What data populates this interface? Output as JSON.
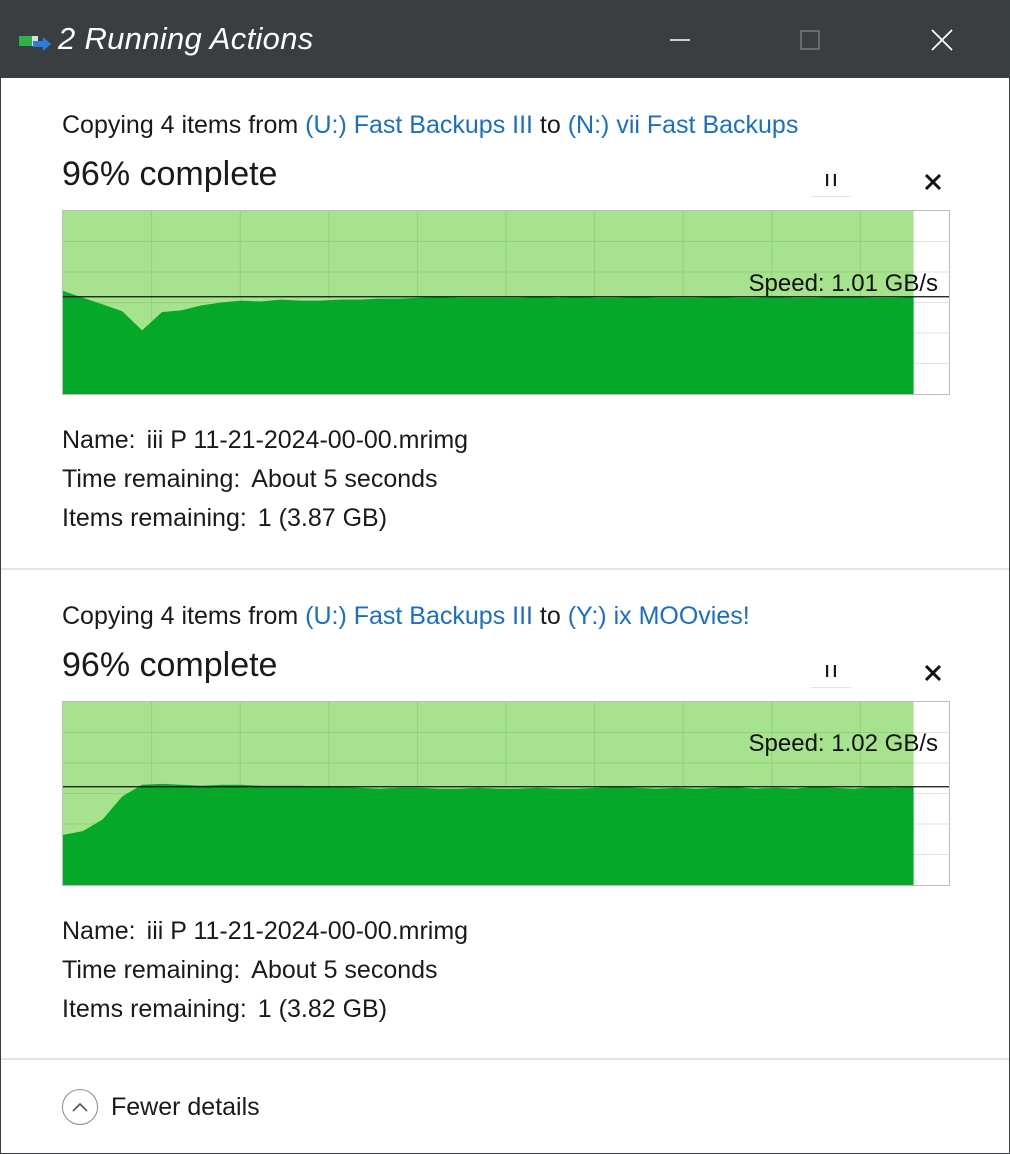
{
  "window": {
    "title": "2 Running Actions",
    "icon": "copy-operation-icon",
    "controls": [
      "minimize-icon",
      "maximize-icon",
      "close-icon"
    ]
  },
  "operations": [
    {
      "prefix": "Copying 4 items from ",
      "source": "(U:) Fast Backups III",
      "connector": " to ",
      "destination": "(N:) vii Fast Backups",
      "percent_text": "96% complete",
      "percent": 96,
      "speed_text": "Speed: 1.01 GB/s",
      "speed_gbps": 1.01,
      "name_label": "Name:",
      "name_value": "iii P 11-21-2024-00-00.mrimg",
      "time_label": "Time remaining:",
      "time_value": "About 5 seconds",
      "items_label": "Items remaining:",
      "items_value": "1 (3.87 GB)",
      "speed_history": [
        1.07,
        1.0,
        0.93,
        0.86,
        0.66,
        0.85,
        0.87,
        0.92,
        0.95,
        0.97,
        0.96,
        0.98,
        0.97,
        0.97,
        0.98,
        0.98,
        0.99,
        0.99,
        1.0,
        1.01,
        1.0,
        1.0,
        1.0,
        1.0,
        1.01,
        1.0,
        1.01,
        1.0,
        1.0,
        1.01,
        1.0,
        1.0,
        1.0,
        1.01,
        1.0,
        1.0,
        1.01,
        1.0,
        1.0,
        1.01,
        1.01,
        1.0,
        1.0,
        1.01
      ]
    },
    {
      "prefix": "Copying 4 items from ",
      "source": "(U:) Fast Backups III",
      "connector": " to ",
      "destination": "(Y:) ix MOOvies!",
      "percent_text": "96% complete",
      "percent": 96,
      "speed_text": "Speed: 1.02 GB/s",
      "speed_gbps": 1.02,
      "name_label": "Name:",
      "name_value": "iii P 11-21-2024-00-00.mrimg",
      "time_label": "Time remaining:",
      "time_value": "About 5 seconds",
      "items_label": "Items remaining:",
      "items_value": "1 (3.82 GB)",
      "speed_history": [
        0.52,
        0.56,
        0.68,
        0.92,
        1.04,
        1.05,
        1.04,
        1.03,
        1.04,
        1.04,
        1.03,
        1.03,
        1.03,
        1.02,
        1.02,
        1.01,
        1.0,
        1.01,
        1.01,
        1.0,
        1.0,
        1.01,
        1.0,
        1.0,
        1.01,
        1.0,
        1.0,
        1.01,
        1.02,
        1.01,
        1.0,
        1.01,
        1.0,
        1.01,
        1.02,
        1.0,
        1.01,
        1.0,
        1.02,
        1.01,
        1.0,
        1.02,
        1.01,
        1.02
      ]
    }
  ],
  "footer": {
    "label": "Fewer details",
    "icon": "chevron-up-icon"
  },
  "colors": {
    "titlebar": "#3a3e41",
    "link": "#1a6fc2",
    "graph_fill": "#06a82a",
    "graph_progress": "#a7e28e",
    "graph_grid": "#8fd478"
  }
}
